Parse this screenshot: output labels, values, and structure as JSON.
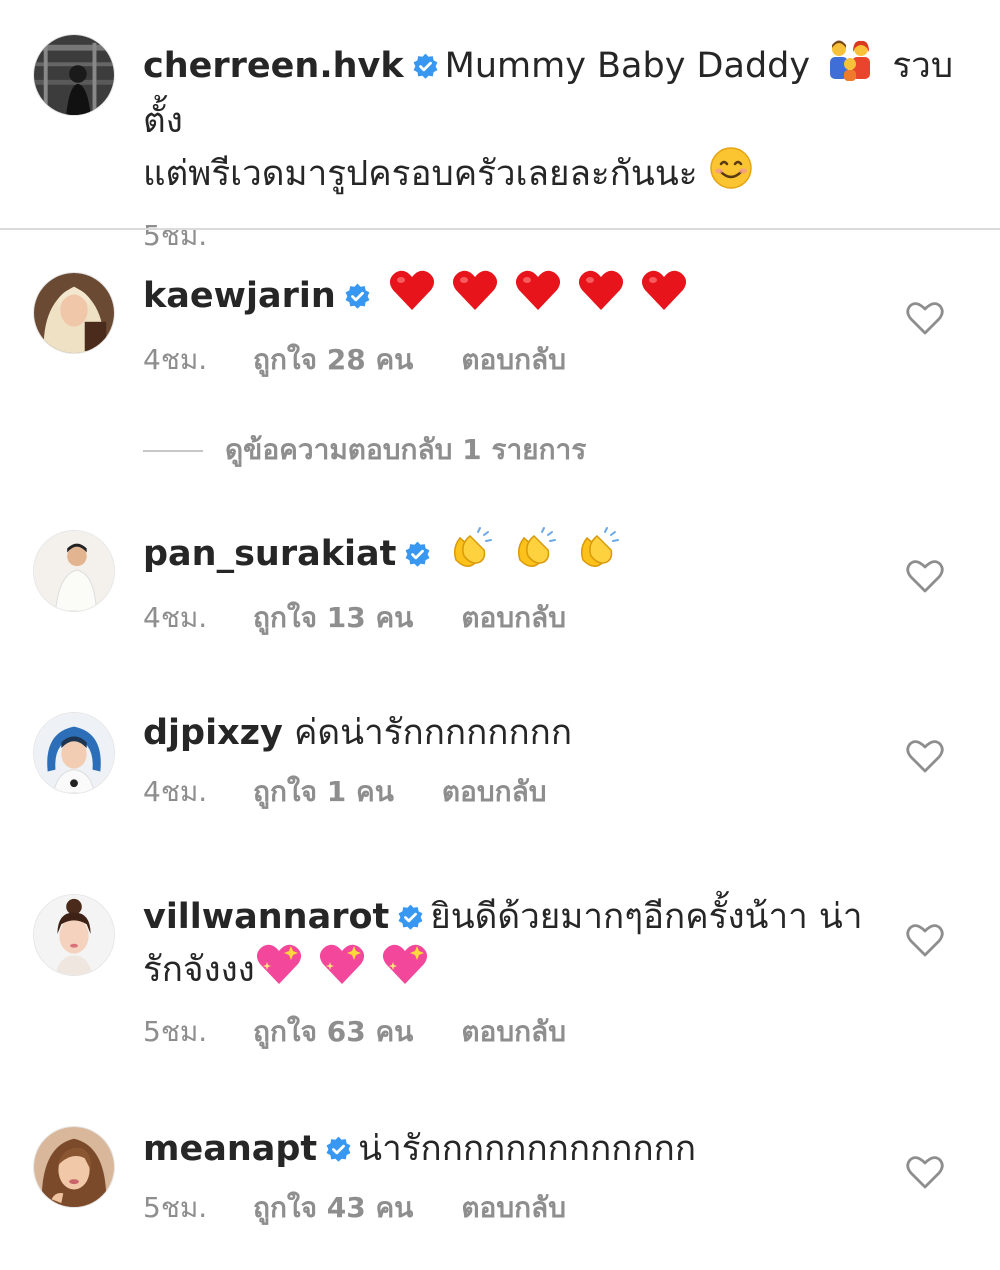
{
  "caption": {
    "username": "cherreen.hvk",
    "verified": true,
    "text_line1": "Mummy Baby Daddy",
    "text_line1_suffix": "รวบตั้ง",
    "text_line2": "แต่พรีเวดมารูปครอบครัวเลยละกันนะ",
    "time": "5ชม."
  },
  "comments": [
    {
      "username": "kaewjarin",
      "verified": true,
      "text": "",
      "emoji": "red-heart-emoji",
      "emoji_count": 5,
      "time": "4ชม.",
      "likes": "ถูกใจ 28 คน",
      "reply": "ตอบกลับ"
    },
    {
      "username": "pan_surakiat",
      "verified": true,
      "text": "",
      "emoji": "clapping-hands-emoji",
      "emoji_count": 3,
      "time": "4ชม.",
      "likes": "ถูกใจ 13 คน",
      "reply": "ตอบกลับ"
    },
    {
      "username": "djpixzy",
      "verified": false,
      "text": "ค่ดน่ารักกกกกกกก",
      "time": "4ชม.",
      "likes": "ถูกใจ 1 คน",
      "reply": "ตอบกลับ"
    },
    {
      "username": "villwannarot",
      "verified": true,
      "text": "ยินดีด้วยมากๆอีกครั้งน้าา น่า",
      "text_line2": "รักจังงง",
      "emoji": "sparkling-heart-emoji",
      "emoji_count": 3,
      "time": "5ชม.",
      "likes": "ถูกใจ 63 คน",
      "reply": "ตอบกลับ"
    },
    {
      "username": "meanapt",
      "verified": true,
      "text": "น่ารักกกกกกกกกกกกก",
      "time": "5ชม.",
      "likes": "ถูกใจ 43 คน",
      "reply": "ตอบกลับ"
    }
  ],
  "view_replies": "ดูข้อความตอบกลับ 1 รายการ",
  "colors": {
    "text": "#262626",
    "muted": "#8e8e8e",
    "verified_blue": "#3897f0",
    "divider": "#dbdbdb"
  },
  "icons": {
    "verified": "verified-badge-icon",
    "like": "heart-outline-icon",
    "family_emoji": "family-emoji",
    "smile_emoji": "smiling-face-emoji"
  }
}
